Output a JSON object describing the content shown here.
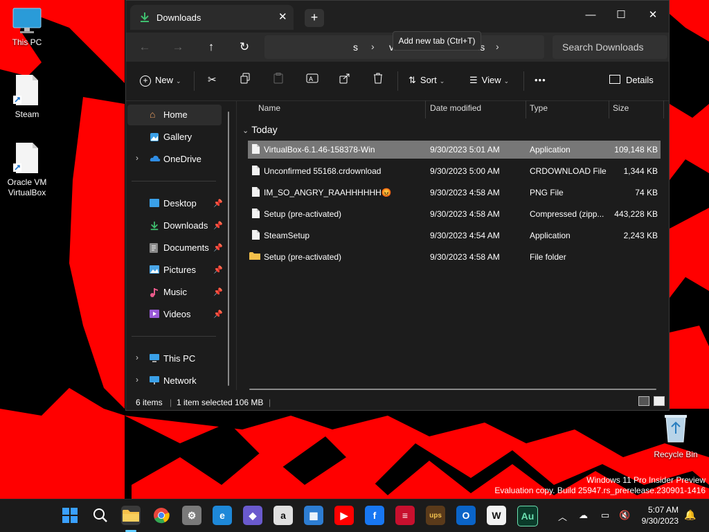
{
  "desktop": {
    "icons": [
      {
        "label": "This PC"
      },
      {
        "label": "Steam"
      },
      {
        "label": "Oracle VM VirtualBox"
      },
      {
        "label": "Recycle Bin"
      }
    ],
    "watermark": {
      "line1": "Windows 11 Pro Insider Preview",
      "line2": "Evaluation copy. Build 25947.rs_prerelease.230901-1416"
    },
    "wallpaper_colors": {
      "primary": "#ff0000",
      "background": "#000000"
    }
  },
  "explorer": {
    "tab": {
      "title": "Downloads",
      "close": "✕"
    },
    "new_tab_label": "+",
    "tooltip": "Add new tab (Ctrl+T)",
    "window_controls": {
      "minimize": "—",
      "maximize": "☐",
      "close": "✕"
    },
    "breadcrumb": [
      "s",
      "vm6",
      "Downloads"
    ],
    "search_placeholder": "Search Downloads",
    "toolbar": {
      "new": "New",
      "sort": "Sort",
      "view": "View",
      "more": "•••",
      "details": "Details"
    },
    "nav": {
      "home": "Home",
      "gallery": "Gallery",
      "onedrive": "OneDrive",
      "desktop": "Desktop",
      "downloads": "Downloads",
      "documents": "Documents",
      "pictures": "Pictures",
      "music": "Music",
      "videos": "Videos",
      "this_pc": "This PC",
      "network": "Network"
    },
    "columns": {
      "name": "Name",
      "date": "Date modified",
      "type": "Type",
      "size": "Size"
    },
    "group": "Today",
    "files": [
      {
        "name": "VirtualBox-6.1.46-158378-Win",
        "date": "9/30/2023 5:01 AM",
        "type": "Application",
        "size": "109,148 KB",
        "kind": "file",
        "selected": true
      },
      {
        "name": "Unconfirmed 55168.crdownload",
        "date": "9/30/2023 5:00 AM",
        "type": "CRDOWNLOAD File",
        "size": "1,344 KB",
        "kind": "file",
        "selected": false
      },
      {
        "name": "IM_SO_ANGRY_RAAHHHHHH😡",
        "date": "9/30/2023 4:58 AM",
        "type": "PNG File",
        "size": "74 KB",
        "kind": "file",
        "selected": false
      },
      {
        "name": "Setup (pre-activated)",
        "date": "9/30/2023 4:58 AM",
        "type": "Compressed (zipp...",
        "size": "443,228 KB",
        "kind": "file",
        "selected": false
      },
      {
        "name": "SteamSetup",
        "date": "9/30/2023 4:54 AM",
        "type": "Application",
        "size": "2,243 KB",
        "kind": "file",
        "selected": false
      },
      {
        "name": "Setup (pre-activated)",
        "date": "9/30/2023 4:58 AM",
        "type": "File folder",
        "size": "",
        "kind": "folder",
        "selected": false
      }
    ],
    "status": {
      "count": "6 items",
      "selected": "1 item selected  106 MB"
    }
  },
  "taskbar": {
    "apps": [
      {
        "name": "start",
        "glyph": "",
        "color": "#3aa0ff"
      },
      {
        "name": "search",
        "glyph": "",
        "color": "#ffffff"
      },
      {
        "name": "file-explorer",
        "glyph": "",
        "color": "#f5c04a"
      },
      {
        "name": "chrome",
        "glyph": "",
        "color": "#e8453c"
      },
      {
        "name": "settings",
        "glyph": "⚙",
        "color": "#7a7a7a"
      },
      {
        "name": "edge",
        "glyph": "e",
        "color": "#1e88d8"
      },
      {
        "name": "copilot",
        "glyph": "◆",
        "color": "#6a5acd"
      },
      {
        "name": "amazon",
        "glyph": "a",
        "color": "#e0e0e0"
      },
      {
        "name": "store",
        "glyph": "▦",
        "color": "#2d7dd2"
      },
      {
        "name": "youtube",
        "glyph": "▶",
        "color": "#ff0000"
      },
      {
        "name": "facebook",
        "glyph": "f",
        "color": "#1877f2"
      },
      {
        "name": "bank-of-america",
        "glyph": "≡",
        "color": "#c8102e"
      },
      {
        "name": "ups",
        "glyph": "ups",
        "color": "#5a3a1a"
      },
      {
        "name": "outlook",
        "glyph": "O",
        "color": "#0a64c8"
      },
      {
        "name": "wikipedia",
        "glyph": "W",
        "color": "#f2f2f2"
      },
      {
        "name": "audition",
        "glyph": "Au",
        "color": "#0b3b2a"
      }
    ],
    "tray": {
      "chevron": "︿",
      "time": "5:07 AM",
      "date": "9/30/2023"
    }
  }
}
